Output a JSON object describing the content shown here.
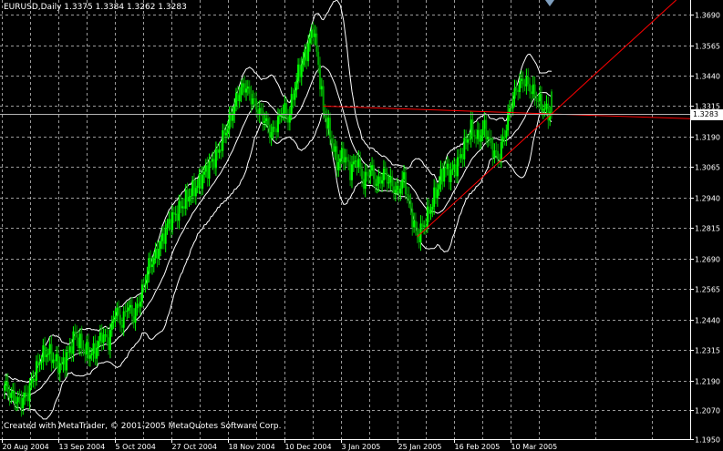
{
  "header": {
    "title": "EURUSD,Daily  1.3375 1.3384 1.3262 1.3283"
  },
  "footer": {
    "copyright": "Created with MetaTrader, © 2001-2005 MetaQuotes Software Corp."
  },
  "current_price": "1.3283",
  "colors": {
    "background": "#000000",
    "grid": "#9a9a9a",
    "bull": "#00ff00",
    "bear": "#00a000",
    "bands": "#ffffff",
    "trendline": "#ff0000",
    "current_price_line": "#b4b4b4"
  },
  "chart_data": {
    "type": "candlestick",
    "symbol": "EURUSD",
    "timeframe": "Daily",
    "ohlc_last": {
      "open": 1.3375,
      "high": 1.3384,
      "low": 1.3262,
      "close": 1.3283
    },
    "ylim": [
      1.195,
      1.375
    ],
    "y_ticks": [
      "1.3690",
      "1.3565",
      "1.3440",
      "1.3315",
      "1.3190",
      "1.3065",
      "1.2940",
      "1.2815",
      "1.2690",
      "1.2565",
      "1.2440",
      "1.2315",
      "1.2190",
      "1.2070",
      "1.1950"
    ],
    "x_ticks": [
      "20 Aug 2004",
      "13 Sep 2004",
      "5 Oct 2004",
      "27 Oct 2004",
      "18 Nov 2004",
      "10 Dec 2004",
      "3 Jan 2005",
      "25 Jan 2005",
      "16 Feb 2005",
      "10 Mar 2005"
    ],
    "grid": true,
    "indicators": [
      "Bollinger Bands"
    ],
    "close_path": [
      [
        0,
        1.217
      ],
      [
        4,
        1.213
      ],
      [
        9,
        1.21
      ],
      [
        14,
        1.214
      ],
      [
        18,
        1.222
      ],
      [
        22,
        1.229
      ],
      [
        26,
        1.231
      ],
      [
        30,
        1.227
      ],
      [
        34,
        1.225
      ],
      [
        38,
        1.23
      ],
      [
        42,
        1.238
      ],
      [
        46,
        1.233
      ],
      [
        50,
        1.23
      ],
      [
        54,
        1.231
      ],
      [
        58,
        1.238
      ],
      [
        62,
        1.235
      ],
      [
        66,
        1.248
      ],
      [
        70,
        1.242
      ],
      [
        73,
        1.25
      ],
      [
        77,
        1.245
      ],
      [
        81,
        1.253
      ],
      [
        86,
        1.266
      ],
      [
        90,
        1.27
      ],
      [
        94,
        1.277
      ],
      [
        98,
        1.284
      ],
      [
        103,
        1.288
      ],
      [
        107,
        1.292
      ],
      [
        111,
        1.296
      ],
      [
        115,
        1.299
      ],
      [
        119,
        1.304
      ],
      [
        123,
        1.308
      ],
      [
        127,
        1.312
      ],
      [
        131,
        1.32
      ],
      [
        135,
        1.327
      ],
      [
        139,
        1.336
      ],
      [
        143,
        1.34
      ],
      [
        147,
        1.335
      ],
      [
        151,
        1.33
      ],
      [
        155,
        1.326
      ],
      [
        159,
        1.32
      ],
      [
        163,
        1.325
      ],
      [
        166,
        1.331
      ],
      [
        169,
        1.326
      ],
      [
        172,
        1.336
      ],
      [
        175,
        1.345
      ],
      [
        178,
        1.35
      ],
      [
        181,
        1.356
      ],
      [
        184,
        1.364
      ],
      [
        187,
        1.348
      ],
      [
        190,
        1.33
      ],
      [
        194,
        1.32
      ],
      [
        198,
        1.308
      ],
      [
        202,
        1.312
      ],
      [
        206,
        1.305
      ],
      [
        210,
        1.31
      ],
      [
        214,
        1.3
      ],
      [
        218,
        1.306
      ],
      [
        222,
        1.299
      ],
      [
        226,
        1.304
      ],
      [
        230,
        1.3
      ],
      [
        234,
        1.296
      ],
      [
        238,
        1.302
      ],
      [
        242,
        1.288
      ],
      [
        246,
        1.278
      ],
      [
        250,
        1.283
      ],
      [
        254,
        1.29
      ],
      [
        258,
        1.298
      ],
      [
        262,
        1.306
      ],
      [
        266,
        1.304
      ],
      [
        270,
        1.308
      ],
      [
        274,
        1.315
      ],
      [
        278,
        1.322
      ],
      [
        282,
        1.318
      ],
      [
        286,
        1.323
      ],
      [
        290,
        1.315
      ],
      [
        294,
        1.31
      ],
      [
        298,
        1.32
      ],
      [
        302,
        1.333
      ],
      [
        306,
        1.34
      ],
      [
        310,
        1.342
      ],
      [
        314,
        1.338
      ],
      [
        318,
        1.334
      ],
      [
        322,
        1.33
      ],
      [
        326,
        1.3283
      ]
    ]
  }
}
